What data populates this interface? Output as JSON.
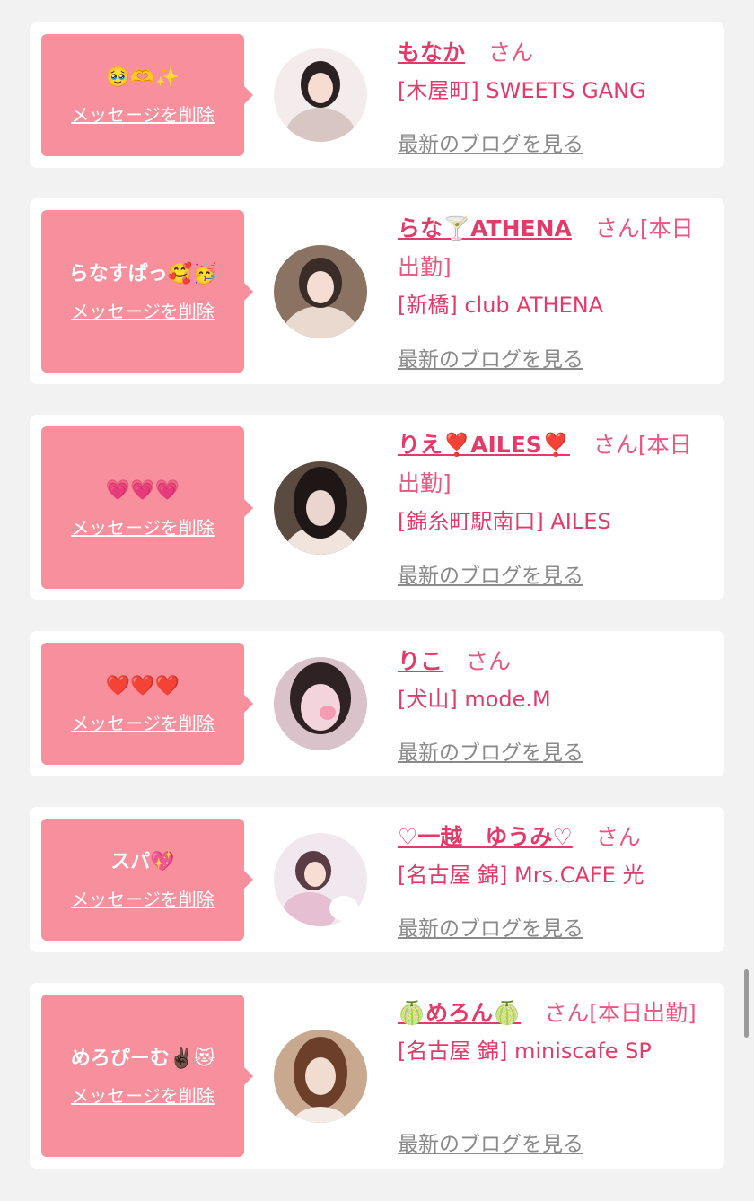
{
  "cards": [
    {
      "message": "🥹🫶✨",
      "delete_label": "メッセージを削除",
      "name": "もなか",
      "suffix": "さん",
      "shop": "[木屋町] SWEETS GANG",
      "blog_link": "最新のブログを見る",
      "avatar_colors": [
        "#f4ecec",
        "#d7c6c2",
        "#2a2222"
      ]
    },
    {
      "message": "らなすぱっ🥰🥳",
      "delete_label": "メッセージを削除",
      "name": "らな🍸ATHENA",
      "suffix": "さん[本日出勤]",
      "shop": "[新橋] club ATHENA",
      "blog_link": "最新のブログを見る",
      "avatar_colors": [
        "#8a7362",
        "#e9d9cf",
        "#3a2c26"
      ]
    },
    {
      "message": "💗💗💗",
      "delete_label": "メッセージを削除",
      "name": "りえ❣️AILES❣️",
      "suffix": "さん[本日出勤]",
      "shop": "[錦糸町駅南口] AILES",
      "blog_link": "最新のブログを見る",
      "avatar_colors": [
        "#5a4a40",
        "#ead6ce",
        "#1e1716"
      ]
    },
    {
      "message": "❤️❤️❤️",
      "delete_label": "メッセージを削除",
      "name": "りこ",
      "suffix": "さん",
      "shop": "[犬山] mode.M",
      "blog_link": "最新のブログを見る",
      "avatar_colors": [
        "#d9c2c9",
        "#f3d4dd",
        "#2e2224"
      ]
    },
    {
      "message": "スパ💖",
      "delete_label": "メッセージを削除",
      "name": "♡一越　ゆうみ♡",
      "suffix": "さん",
      "shop": "[名古屋 錦] Mrs.CAFE 光",
      "blog_link": "最新のブログを見る",
      "avatar_colors": [
        "#f1e8ef",
        "#e6c0d2",
        "#5a3c44"
      ]
    },
    {
      "message": "めろぴーむ✌🏿😻",
      "delete_label": "メッセージを削除",
      "name": "🍈めろん🍈",
      "suffix": "さん[本日出勤]",
      "shop": "[名古屋 錦] miniscafe SP",
      "blog_link": "最新のブログを見る",
      "avatar_colors": [
        "#c9a890",
        "#f1ddd0",
        "#6b3f2a"
      ]
    }
  ]
}
